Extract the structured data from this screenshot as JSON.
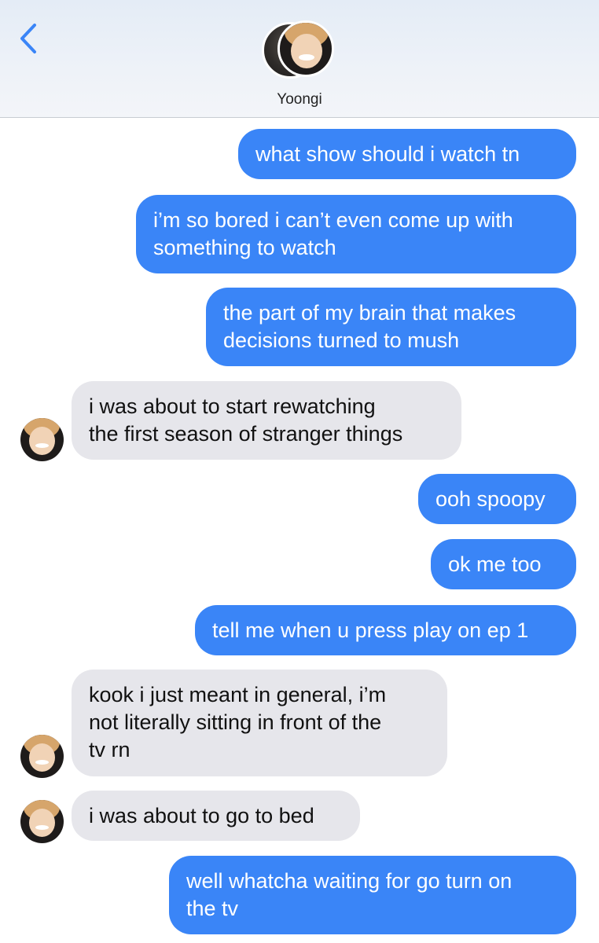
{
  "header": {
    "contact_name": "Yoongi",
    "back_icon": "chevron-left-icon",
    "accent_color": "#3a85f7"
  },
  "messages": [
    {
      "direction": "sent",
      "text": "what show should i watch tn"
    },
    {
      "direction": "sent",
      "text": "i’m so bored i can’t even come up with\nsomething to watch"
    },
    {
      "direction": "sent",
      "text": "the part of my brain that makes\ndecisions turned to mush"
    },
    {
      "direction": "received",
      "text": "i was about to start rewatching\nthe first season of stranger things"
    },
    {
      "direction": "sent",
      "text": "ooh spoopy"
    },
    {
      "direction": "sent",
      "text": "ok me too"
    },
    {
      "direction": "sent",
      "text": "tell me when u press play on ep 1"
    },
    {
      "direction": "received",
      "text": "kook i just meant in general, i’m\nnot literally sitting in front of the\ntv rn"
    },
    {
      "direction": "received",
      "text": "i was about to go to bed"
    },
    {
      "direction": "sent",
      "text": "well whatcha waiting for go turn on\nthe tv"
    }
  ]
}
